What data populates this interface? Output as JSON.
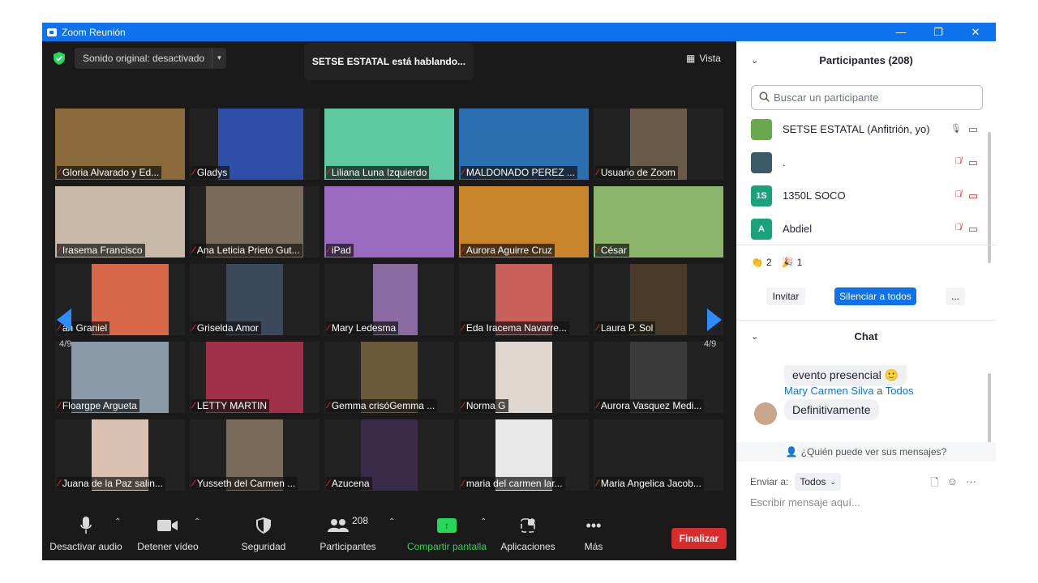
{
  "window": {
    "title": "Zoom Reunión",
    "minimize": "—",
    "restore": "❐",
    "close": "✕"
  },
  "top": {
    "audio_label": "Sonido original: desactivado",
    "audio_arrow": "▼",
    "speaking": "SETSE ESTATAL está hablando...",
    "view_label": "Vista",
    "view_icon": "▦"
  },
  "pagination": {
    "left": "4/9",
    "right": "4/9"
  },
  "tiles": [
    {
      "name": "Gloria Alvarado y Ed...",
      "bg": "#8a6a3a"
    },
    {
      "name": "Gladys",
      "bg": "#2d4fa8"
    },
    {
      "name": "Liliana Luna Izquierdo",
      "bg": "#5dc9a0"
    },
    {
      "name": "MALDONADO PEREZ ...",
      "bg": "#2a6fb0"
    },
    {
      "name": "Usuario de Zoom",
      "bg": "#6a5a4a"
    },
    {
      "name": "Irasema Francisco",
      "bg": "#c9b9a9"
    },
    {
      "name": "Ana Leticia Prieto Gut...",
      "bg": "#7a6a5a"
    },
    {
      "name": "iPad",
      "bg": "#9a6ac0"
    },
    {
      "name": "Aurora Aguirre Cruz",
      "bg": "#c9852a"
    },
    {
      "name": "César",
      "bg": "#8ab56a"
    },
    {
      "name": "an Graniel",
      "bg": "#d9684a"
    },
    {
      "name": "Griselda Amor",
      "bg": "#3a4a5a"
    },
    {
      "name": "Mary Ledesma",
      "bg": "#8a6aa0"
    },
    {
      "name": "Eda Iracema Navarre...",
      "bg": "#c9605a"
    },
    {
      "name": "Laura P. Sol",
      "bg": "#4a3a2a"
    },
    {
      "name": "Floargpe Argueta",
      "bg": "#8a9aa8"
    },
    {
      "name": "LETTY MARTIN",
      "bg": "#a0304a"
    },
    {
      "name": "Gemma crisóGemma ...",
      "bg": "#6a5a3a"
    },
    {
      "name": "Norma G",
      "bg": "#e0d8d0"
    },
    {
      "name": "Aurora Vasquez Medi...",
      "bg": "#3a3a3a"
    },
    {
      "name": "Juana de la Paz salin...",
      "bg": "#d9c0b0"
    },
    {
      "name": "Yusseth del Carmen ...",
      "bg": "#7a6a5a"
    },
    {
      "name": "Azucena",
      "bg": "#3a2a4a"
    },
    {
      "name": "maria del carmen lar...",
      "bg": "#e8e8e8"
    },
    {
      "name": "Maria Angelica Jacob...",
      "bg": "#222222"
    }
  ],
  "toolbar": {
    "mute": "Desactivar audio",
    "video": "Detener vídeo",
    "security": "Seguridad",
    "participants": "Participantes",
    "participants_count": "208",
    "share": "Compartir pantalla",
    "apps": "Aplicaciones",
    "more": "Más",
    "end": "Finalizar"
  },
  "participants_panel": {
    "title": "Participantes (208)",
    "search_placeholder": "Buscar un participante",
    "list": [
      {
        "initials": "",
        "name": "SETSE ESTATAL (Anfitrión, yo)",
        "avatar_color": "#6aa84f",
        "muted": false
      },
      {
        "initials": "",
        "name": ".",
        "avatar_color": "#3a5a6a",
        "muted": true
      },
      {
        "initials": "1S",
        "name": "1350L SOCO",
        "avatar_color": "#1aa37a",
        "muted": true
      },
      {
        "initials": "A",
        "name": "Abdiel",
        "avatar_color": "#1aa37a",
        "muted": true
      }
    ],
    "reactions": [
      {
        "emoji": "👏",
        "count": "2"
      },
      {
        "emoji": "🎉",
        "count": "1"
      }
    ],
    "invite": "Invitar",
    "mute_all": "Silenciar a todos",
    "more": "..."
  },
  "chat": {
    "title": "Chat",
    "prev_message": "evento presencial 🙂",
    "sender": "Mary Carmen Silva",
    "to_word": "a",
    "recipient": "Todos",
    "message": "Definitivamente",
    "who_can_see": "¿Quién puede ver sus mensajes?",
    "send_to_label": "Enviar a:",
    "send_to_value": "Todos",
    "input_placeholder": "Escribir mensaje aquí..."
  }
}
